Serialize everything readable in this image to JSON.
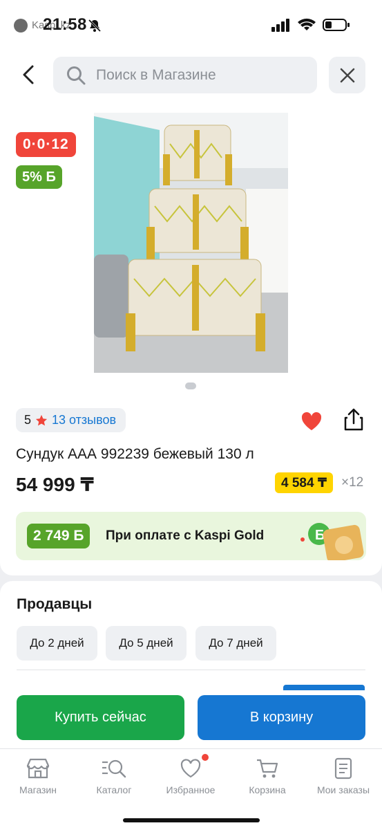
{
  "status_bar": {
    "time": "21:58",
    "back_app": "Kaspi.kz"
  },
  "search": {
    "placeholder": "Поиск в Магазине"
  },
  "badges": {
    "timer": "0·0·12",
    "bonus": "5% Б"
  },
  "product": {
    "rating": "5",
    "reviews": "13 отзывов",
    "title": "Сундук ААА 992239 бежевый 130 л",
    "price": "54 999 ₸",
    "installment": "4 584 ₸",
    "installment_months": "×12"
  },
  "kaspi_gold": {
    "bonus": "2 749 Б",
    "text": "При оплате с Kaspi Gold"
  },
  "sellers": {
    "title": "Продавцы",
    "chips": [
      "До 2 дней",
      "До 5 дней",
      "До 7 дней"
    ]
  },
  "actions": {
    "buy": "Купить сейчас",
    "cart": "В корзину"
  },
  "tabbar": {
    "items": [
      {
        "label": "Магазин",
        "icon": "store-icon"
      },
      {
        "label": "Каталог",
        "icon": "catalog-search-icon"
      },
      {
        "label": "Избранное",
        "icon": "heart-icon"
      },
      {
        "label": "Корзина",
        "icon": "cart-icon"
      },
      {
        "label": "Мои заказы",
        "icon": "orders-icon"
      }
    ]
  },
  "colors": {
    "red": "#f0453a",
    "green": "#57a42a",
    "blue": "#1677d2",
    "yellow": "#ffd400",
    "buy_green": "#1aa64a"
  }
}
